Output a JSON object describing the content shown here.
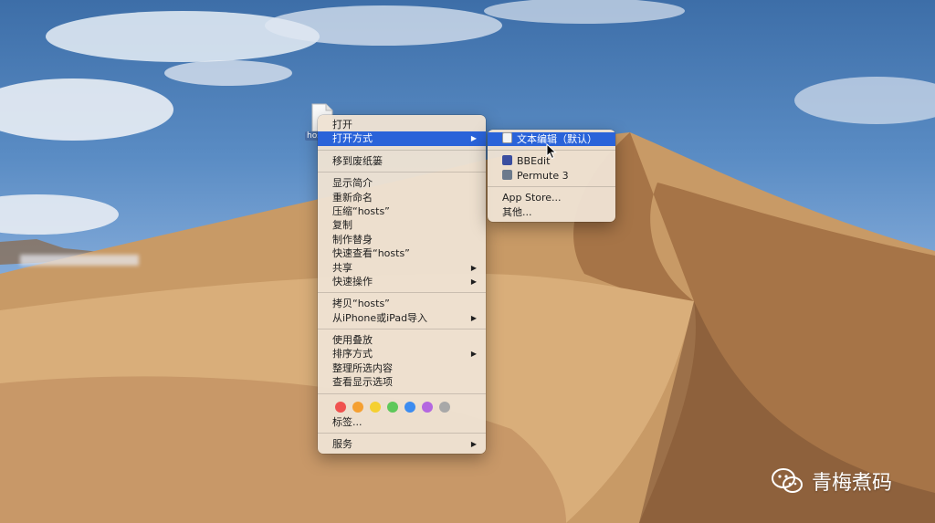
{
  "desktop": {
    "file_label": "hosts"
  },
  "context_menu": {
    "items": [
      {
        "label": "打开"
      },
      {
        "label": "打开方式",
        "highlighted": true,
        "submenu": true
      },
      {
        "label": "移到废纸篓"
      },
      {
        "label": "显示简介"
      },
      {
        "label": "重新命名"
      },
      {
        "label": "压缩“hosts”"
      },
      {
        "label": "复制"
      },
      {
        "label": "制作替身"
      },
      {
        "label": "快速查看“hosts”"
      },
      {
        "label": "共享",
        "submenu": true
      },
      {
        "label": "快速操作",
        "submenu": true
      },
      {
        "label": "拷贝“hosts”"
      },
      {
        "label": "从iPhone或iPad导入",
        "submenu": true
      },
      {
        "label": "使用叠放"
      },
      {
        "label": "排序方式",
        "submenu": true
      },
      {
        "label": "整理所选内容"
      },
      {
        "label": "查看显示选项"
      },
      {
        "label": "标签..."
      },
      {
        "label": "服务",
        "submenu": true
      }
    ],
    "tag_colors": [
      "#f0524f",
      "#f5a032",
      "#f5d031",
      "#5ec85a",
      "#3c8cf0",
      "#b467e0",
      "#a8a8a8"
    ]
  },
  "open_with_submenu": {
    "items": [
      {
        "label": "文本编辑（默认）",
        "highlighted": true,
        "icon": "textedit-icon"
      },
      {
        "label": "BBEdit",
        "icon": "bbedit-icon"
      },
      {
        "label": "Permute 3",
        "icon": "permute-icon"
      },
      {
        "label": "App Store..."
      },
      {
        "label": "其他..."
      }
    ]
  },
  "watermark": {
    "text": "青梅煮码",
    "icon": "wechat-icon"
  },
  "colors": {
    "highlight": "#2a63d9",
    "menu_bg": "#eee2d2"
  }
}
